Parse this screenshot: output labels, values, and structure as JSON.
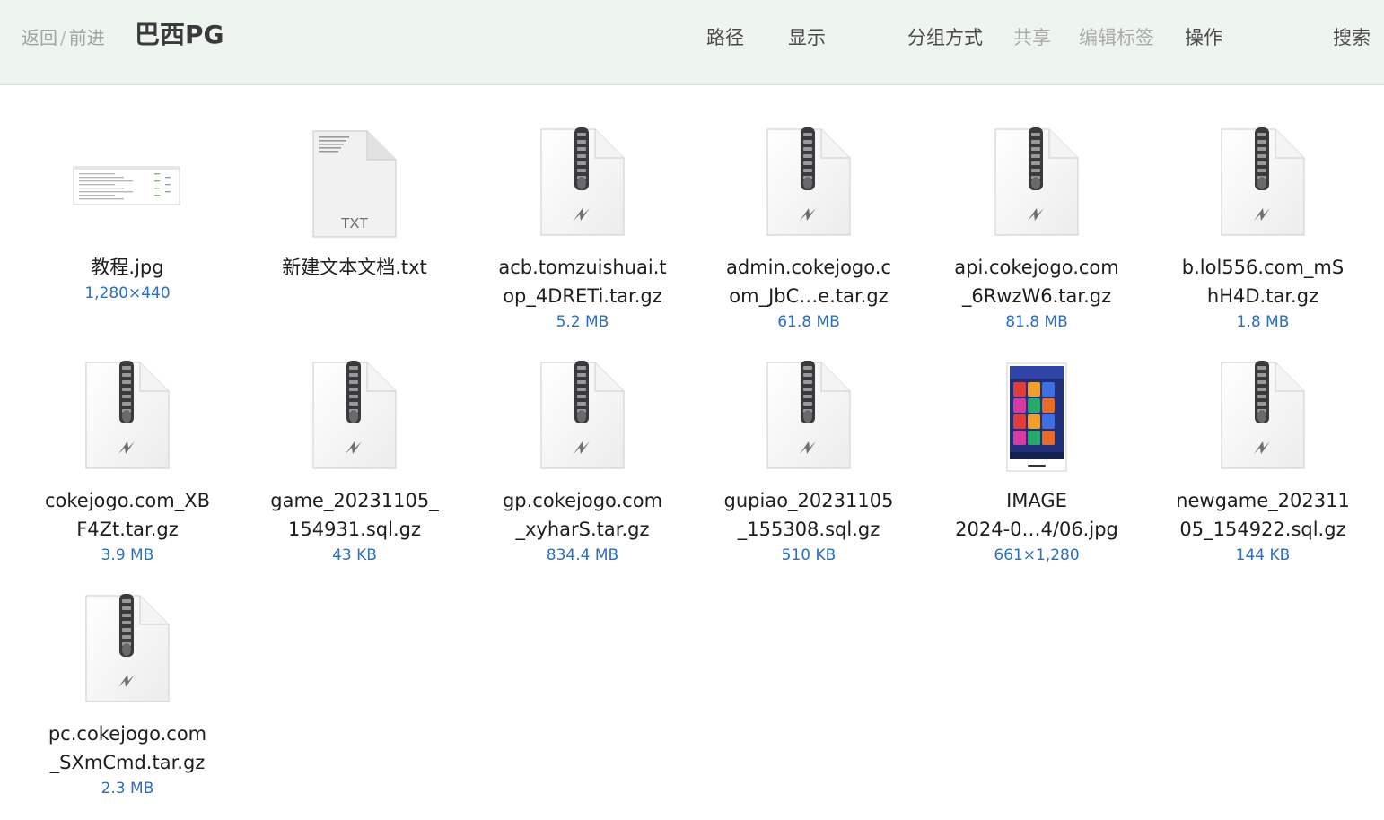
{
  "toolbar": {
    "back": "返回",
    "separator": "/",
    "forward": "前进",
    "title": "巴西PG",
    "path": "路径",
    "display": "显示",
    "group_by": "分组方式",
    "share": "共享",
    "edit_tags": "编辑标签",
    "actions": "操作",
    "search": "搜索"
  },
  "files": [
    {
      "name": "教程.jpg",
      "meta": "1,280×440",
      "kind": "image-wide",
      "icon": "image-thumbnail-icon"
    },
    {
      "name": "新建文本文档.txt",
      "meta": "",
      "kind": "txt",
      "icon": "text-document-icon",
      "badge": "TXT"
    },
    {
      "name": "acb.tomzuishuai.top_4DRETi.tar.gz",
      "display": "acb.tomzuishuai.t\nop_4DRETi.tar.gz",
      "meta": "5.2 MB",
      "kind": "archive",
      "icon": "archive-zipper-icon"
    },
    {
      "name": "admin.cokejogo.com_JbC…e.tar.gz",
      "display": "admin.cokejogo.c\nom_JbC…e.tar.gz",
      "meta": "61.8 MB",
      "kind": "archive",
      "icon": "archive-zipper-icon"
    },
    {
      "name": "api.cokejogo.com_6RwzW6.tar.gz",
      "display": "api.cokejogo.com\n_6RwzW6.tar.gz",
      "meta": "81.8 MB",
      "kind": "archive",
      "icon": "archive-zipper-icon"
    },
    {
      "name": "b.lol556.com_mShH4D.tar.gz",
      "display": "b.lol556.com_mS\nhH4D.tar.gz",
      "meta": "1.8 MB",
      "kind": "archive",
      "icon": "archive-zipper-icon"
    },
    {
      "name": "cokejogo.com_XBF4Zt.tar.gz",
      "display": "cokejogo.com_XB\nF4Zt.tar.gz",
      "meta": "3.9 MB",
      "kind": "archive",
      "icon": "archive-zipper-icon"
    },
    {
      "name": "game_20231105_154931.sql.gz",
      "display": "game_20231105_\n154931.sql.gz",
      "meta": "43 KB",
      "kind": "archive",
      "icon": "archive-zipper-icon"
    },
    {
      "name": "gp.cokejogo.com_xyharS.tar.gz",
      "display": "gp.cokejogo.com\n_xyharS.tar.gz",
      "meta": "834.4 MB",
      "kind": "archive",
      "icon": "archive-zipper-icon"
    },
    {
      "name": "gupiao_20231105_155308.sql.gz",
      "display": "gupiao_20231105\n_155308.sql.gz",
      "meta": "510 KB",
      "kind": "archive",
      "icon": "archive-zipper-icon"
    },
    {
      "name": "IMAGE 2024-0…4/06.jpg",
      "display": "IMAGE\n2024-0…4/06.jpg",
      "meta": "661×1,280",
      "kind": "image-tall",
      "icon": "phone-screenshot-thumbnail-icon"
    },
    {
      "name": "newgame_20231105_154922.sql.gz",
      "display": "newgame_202311\n05_154922.sql.gz",
      "meta": "144 KB",
      "kind": "archive",
      "icon": "archive-zipper-icon"
    },
    {
      "name": "pc.cokejogo.com_SXmCmd.tar.gz",
      "display": "pc.cokejogo.com\n_SXmCmd.tar.gz",
      "meta": "2.3 MB",
      "kind": "archive",
      "icon": "archive-zipper-icon"
    }
  ]
}
